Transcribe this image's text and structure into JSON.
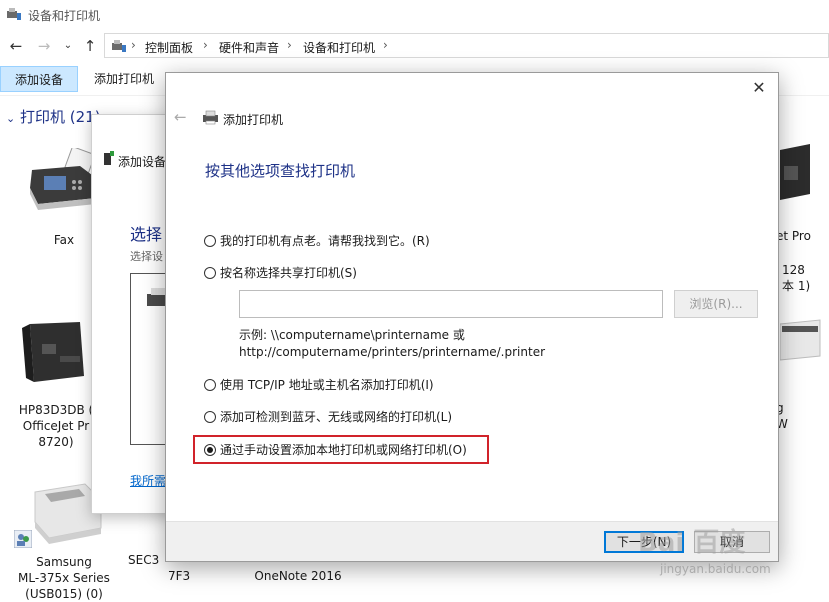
{
  "window": {
    "title": "设备和打印机"
  },
  "address": {
    "crumbs": [
      "控制面板",
      "硬件和声音",
      "设备和打印机"
    ]
  },
  "commandbar": {
    "add_device": "添加设备",
    "add_printer": "添加打印机"
  },
  "group": {
    "header": "打印机 (21)"
  },
  "devices": {
    "fax": "Fax",
    "hp": "HP83D3DB (\nOfficeJet Pr\n8720)",
    "samsung": "Samsung\nML-375x Series\n(USB015) (0)",
    "sec": "SEC3",
    "sec_sub": "7F3",
    "onenote": "OneNote 2016",
    "right1": "et Pro",
    "right2": "128\n本 1)",
    "right3": "g\nW"
  },
  "add_device_dialog": {
    "title": "添加设备",
    "heading": "选择",
    "subtitle": "选择设",
    "link": "我所需"
  },
  "add_printer_dialog": {
    "title": "添加打印机",
    "heading": "按其他选项查找打印机",
    "options": [
      "我的打印机有点老。请帮我找到它。(R)",
      "按名称选择共享打印机(S)",
      "使用 TCP/IP 地址或主机名添加打印机(I)",
      "添加可检测到蓝牙、无线或网络的打印机(L)",
      "通过手动设置添加本地打印机或网络打印机(O)"
    ],
    "selected_option": 4,
    "share_input_value": "",
    "browse_label": "浏览(R)...",
    "example_line1": "示例: \\\\computername\\printername 或",
    "example_line2": "http://computername/printers/printername/.printer",
    "next_label": "下一步(N)",
    "cancel_label": "取消"
  },
  "watermark": {
    "logo": "Bai 百度",
    "sub": "jingyan.baidu.com"
  },
  "colors": {
    "heading_blue": "#1e3287",
    "highlight_red": "#d1232a",
    "primary_button_border": "#0078d7",
    "active_cmd_bg": "#cce8ff"
  }
}
